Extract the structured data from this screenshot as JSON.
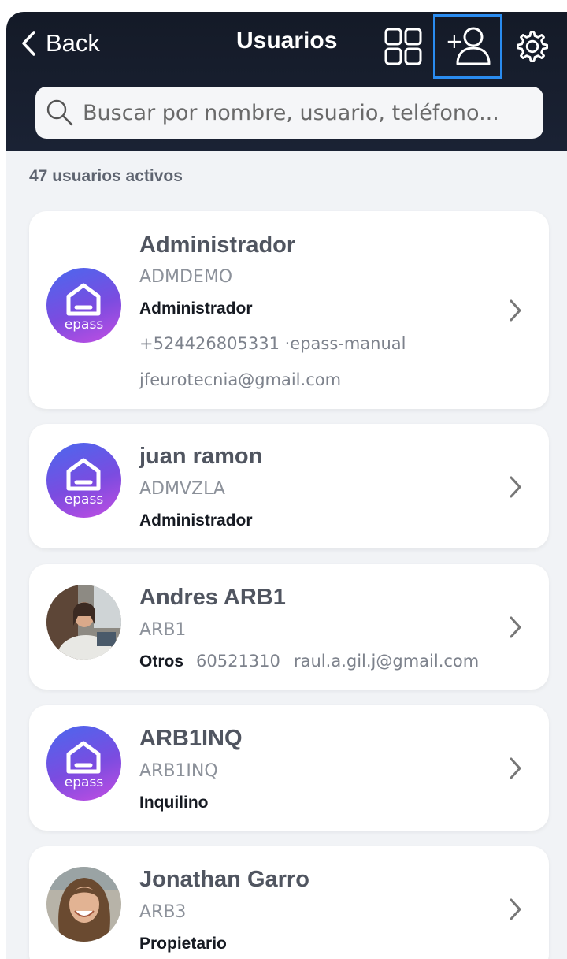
{
  "header": {
    "back_label": "Back",
    "title": "Usuarios",
    "icons": [
      "grid-icon",
      "add-user-icon",
      "gear-icon"
    ]
  },
  "search": {
    "value": "",
    "placeholder": "Buscar por nombre, usuario, teléfono..."
  },
  "summary": {
    "count_label": "47 usuarios activos"
  },
  "users": [
    {
      "name": "Administrador",
      "username": "ADMDEMO",
      "role": "Administrador",
      "phone_line": "+524426805331 ·epass-manual",
      "email": "jfeurotecnia@gmail.com",
      "avatar": "epass",
      "avatar_label": "epass"
    },
    {
      "name": "juan ramon",
      "username": "ADMVZLA",
      "role": "Administrador",
      "avatar": "epass",
      "avatar_label": "epass"
    },
    {
      "name": "Andres ARB1",
      "username": "ARB1",
      "role": "Otros",
      "phone": "60521310",
      "email": "raul.a.gil.j@gmail.com",
      "avatar": "photo-woman-laptop"
    },
    {
      "name": "ARB1INQ",
      "username": "ARB1INQ",
      "role": "Inquilino",
      "avatar": "epass",
      "avatar_label": "epass"
    },
    {
      "name": "Jonathan Garro",
      "username": "ARB3",
      "role": "Propietario",
      "avatar": "photo-woman-smiling"
    }
  ],
  "colors": {
    "header_bg": "#141a27",
    "selected_outline": "#2a8cf0",
    "logo_gradient_start": "#4a68ee",
    "logo_gradient_end": "#c24ee2",
    "page_bg": "#f1f3f6"
  }
}
